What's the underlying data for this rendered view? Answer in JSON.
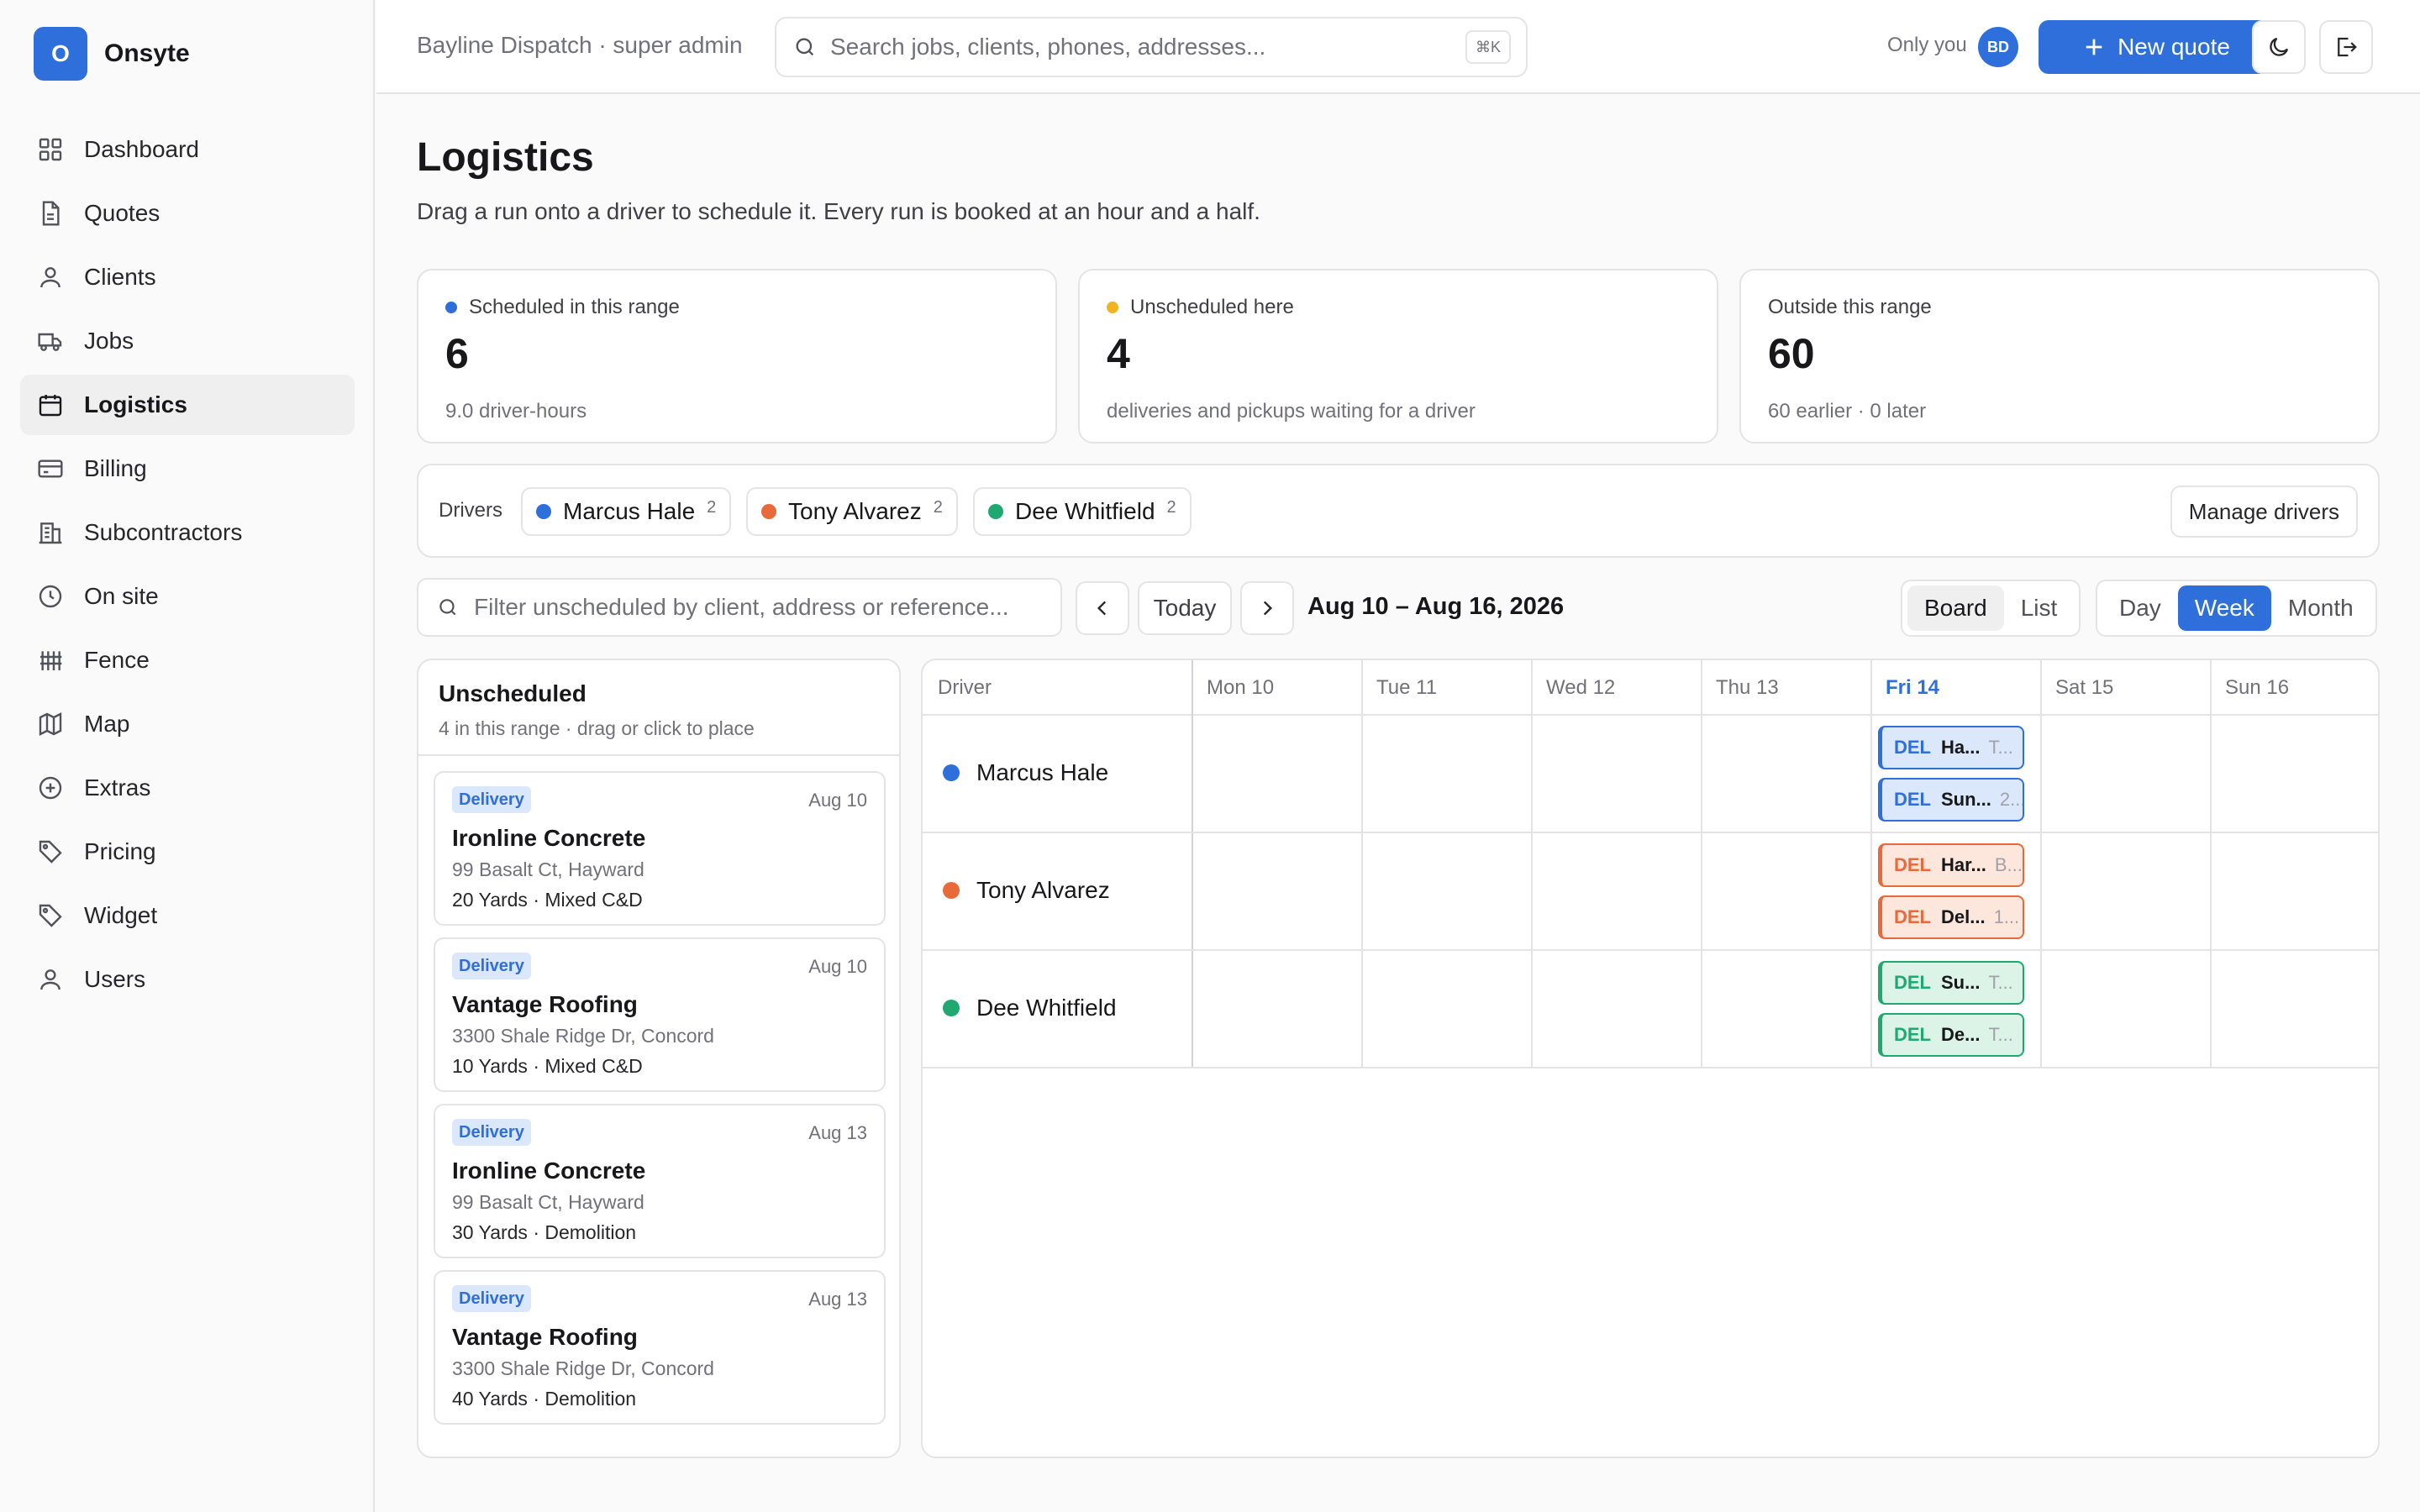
{
  "app": {
    "logo_letter": "O",
    "name": "Onsyte",
    "accent": "#2f6fdb"
  },
  "sidebar": {
    "items": [
      {
        "label": "Dashboard",
        "icon": "grid-icon"
      },
      {
        "label": "Quotes",
        "icon": "document-icon"
      },
      {
        "label": "Clients",
        "icon": "user-icon"
      },
      {
        "label": "Jobs",
        "icon": "truck-icon"
      },
      {
        "label": "Logistics",
        "icon": "calendar-icon",
        "active": true
      },
      {
        "label": "Billing",
        "icon": "credit-card-icon"
      },
      {
        "label": "Subcontractors",
        "icon": "building-icon"
      },
      {
        "label": "On site",
        "icon": "clock-icon"
      },
      {
        "label": "Fence",
        "icon": "fence-icon"
      },
      {
        "label": "Map",
        "icon": "map-icon"
      },
      {
        "label": "Extras",
        "icon": "plus-circle-icon"
      },
      {
        "label": "Pricing",
        "icon": "tag-icon"
      },
      {
        "label": "Widget",
        "icon": "tag-icon"
      },
      {
        "label": "Users",
        "icon": "user-icon"
      }
    ]
  },
  "topbar": {
    "org": "Bayline Dispatch · super admin",
    "search_placeholder": "Search jobs, clients, phones, addresses...",
    "shortcut": "⌘K",
    "visibility": "Only you",
    "avatar_initials": "BD",
    "new_quote_label": "New quote"
  },
  "page": {
    "title": "Logistics",
    "subtitle": "Drag a run onto a driver to schedule it. Every run is booked at an hour and a half."
  },
  "stats": [
    {
      "label": "Scheduled in this range",
      "value": "6",
      "note": "9.0 driver-hours",
      "dot_color": "#2f6fdb"
    },
    {
      "label": "Unscheduled here",
      "value": "4",
      "note": "deliveries and pickups waiting for a driver",
      "dot_color": "#f0b420"
    },
    {
      "label": "Outside this range",
      "value": "60",
      "note": "60 earlier · 0 later"
    }
  ],
  "drivers": {
    "label": "Drivers",
    "list": [
      {
        "name": "Marcus Hale",
        "count": "2",
        "color": "#2f6fdb"
      },
      {
        "name": "Tony Alvarez",
        "count": "2",
        "color": "#e8693a"
      },
      {
        "name": "Dee Whitfield",
        "count": "2",
        "color": "#1fa971"
      }
    ],
    "manage_label": "Manage drivers"
  },
  "toolbar": {
    "filter_placeholder": "Filter unscheduled by client, address or reference...",
    "today_label": "Today",
    "range": "Aug 10 – Aug 16, 2026",
    "view_modes": [
      "Board",
      "List"
    ],
    "active_view_mode": "Board",
    "periods": [
      "Day",
      "Week",
      "Month"
    ],
    "active_period": "Week"
  },
  "unscheduled": {
    "title": "Unscheduled",
    "subtitle": "4 in this range · drag or click to place",
    "cards": [
      {
        "type": "Delivery",
        "date": "Aug 10",
        "client": "Ironline Concrete",
        "address": "99 Basalt Ct, Hayward",
        "meta": "20 Yards · Mixed C&D"
      },
      {
        "type": "Delivery",
        "date": "Aug 10",
        "client": "Vantage Roofing",
        "address": "3300 Shale Ridge Dr, Concord",
        "meta": "10 Yards · Mixed C&D"
      },
      {
        "type": "Delivery",
        "date": "Aug 13",
        "client": "Ironline Concrete",
        "address": "99 Basalt Ct, Hayward",
        "meta": "30 Yards · Demolition"
      },
      {
        "type": "Delivery",
        "date": "Aug 13",
        "client": "Vantage Roofing",
        "address": "3300 Shale Ridge Dr, Concord",
        "meta": "40 Yards · Demolition"
      }
    ]
  },
  "board": {
    "driver_col": "Driver",
    "days": [
      "Mon 10",
      "Tue 11",
      "Wed 12",
      "Thu 13",
      "Fri 14",
      "Sat 15",
      "Sun 16"
    ],
    "today": "Fri 14",
    "rows": [
      {
        "driver": "Marcus Hale",
        "color": "#2f6fdb",
        "runs": [
          {
            "day": "Fri 14",
            "tag": "DEL",
            "client": "Ha...",
            "extra": "T..."
          },
          {
            "day": "Fri 14",
            "tag": "DEL",
            "client": "Sun...",
            "extra": "2..."
          }
        ]
      },
      {
        "driver": "Tony Alvarez",
        "color": "#e8693a",
        "runs": [
          {
            "day": "Fri 14",
            "tag": "DEL",
            "client": "Har...",
            "extra": "B..."
          },
          {
            "day": "Fri 14",
            "tag": "DEL",
            "client": "Del...",
            "extra": "1..."
          }
        ]
      },
      {
        "driver": "Dee Whitfield",
        "color": "#1fa971",
        "runs": [
          {
            "day": "Fri 14",
            "tag": "DEL",
            "client": "Su...",
            "extra": "T..."
          },
          {
            "day": "Fri 14",
            "tag": "DEL",
            "client": "De...",
            "extra": "T..."
          }
        ]
      }
    ]
  }
}
